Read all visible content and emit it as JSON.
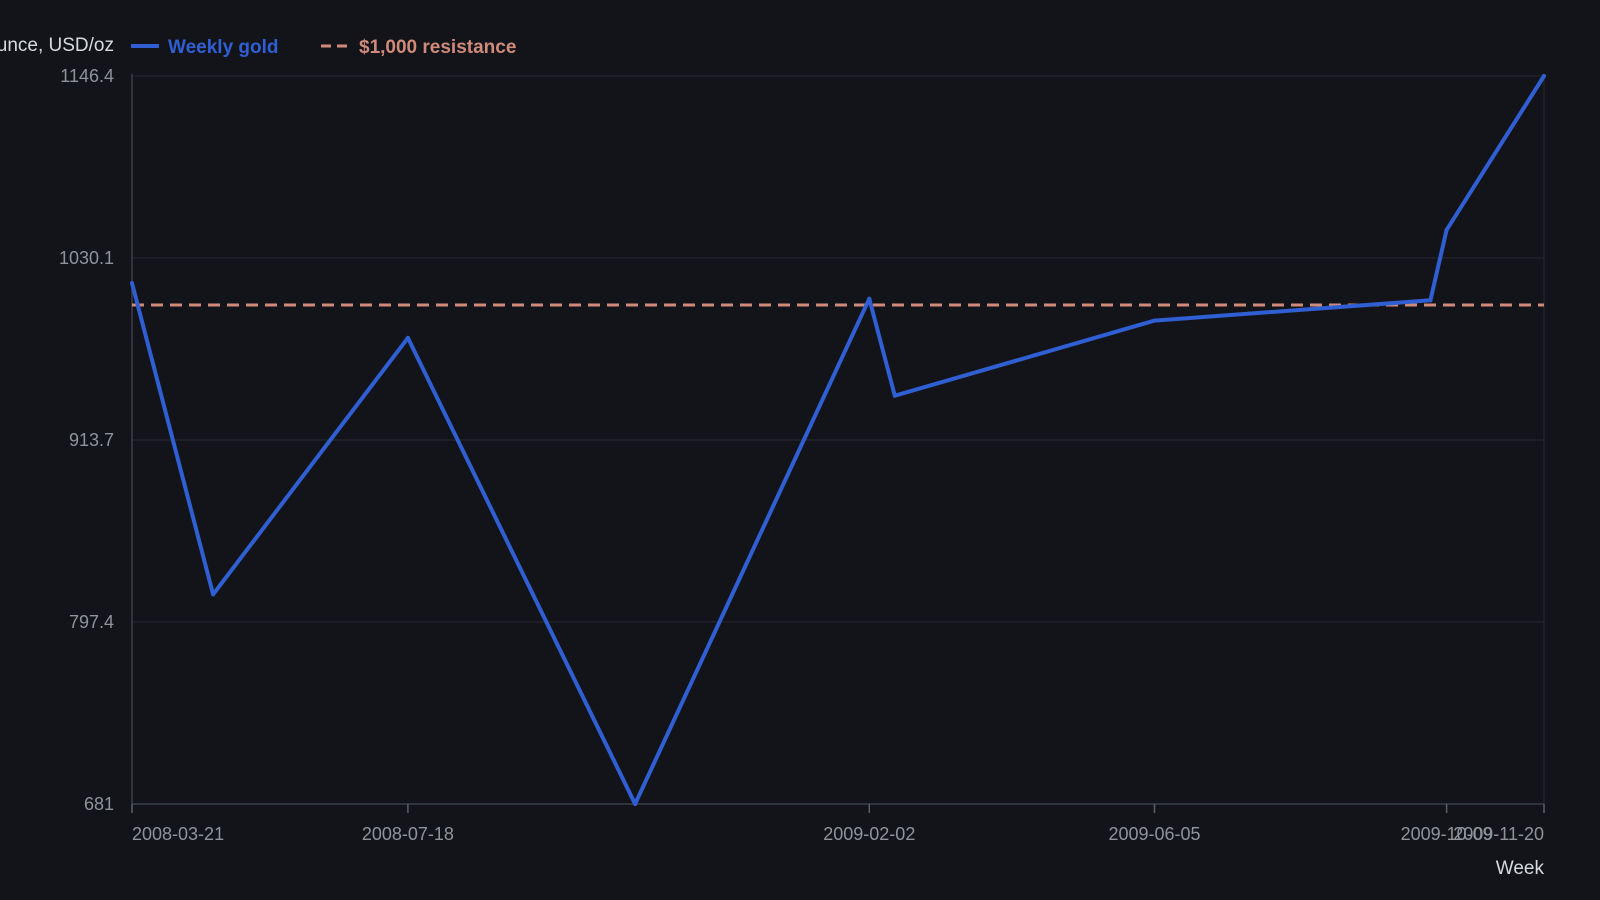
{
  "chart_data": {
    "type": "line",
    "title": "",
    "ylabel": "Price per ounce, USD/oz",
    "xlabel": "Week",
    "ylim": [
      681,
      1146.4
    ],
    "yticks": [
      "681",
      "797.4",
      "913.7",
      "1030.1",
      "1146.4"
    ],
    "xticks": [
      "2008-03-21",
      "2008-07-18",
      "2009-02-02",
      "2009-06-05",
      "2009-10-09",
      "2009-11-20"
    ],
    "grid": true,
    "legend_position": "top-left",
    "series": [
      {
        "name": "Weekly gold",
        "color": "#2f5fd3",
        "points": [
          {
            "x": "2008-03-21",
            "y": 1014
          },
          {
            "x": "2008-04-25",
            "y": 815
          },
          {
            "x": "2008-07-18",
            "y": 979
          },
          {
            "x": "2008-10-24",
            "y": 681
          },
          {
            "x": "2009-02-02",
            "y": 1004
          },
          {
            "x": "2009-02-13",
            "y": 942
          },
          {
            "x": "2009-06-05",
            "y": 990
          },
          {
            "x": "2009-10-02",
            "y": 1003
          },
          {
            "x": "2009-10-09",
            "y": 1048
          },
          {
            "x": "2009-11-20",
            "y": 1146.4
          }
        ]
      }
    ],
    "reference_lines": [
      {
        "name": "$1,000 resistance",
        "y": 1000,
        "style": "dashed",
        "color": "#d08a7a"
      }
    ]
  }
}
